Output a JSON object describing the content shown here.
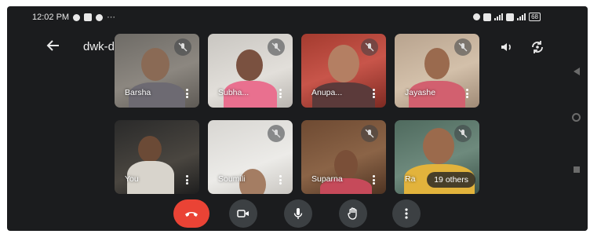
{
  "status_bar": {
    "time": "12:02 PM",
    "left_icons": [
      "whatsapp-icon",
      "video-app-icon",
      "chrome-icon"
    ],
    "overflow": "···",
    "battery": "68"
  },
  "top_bar": {
    "title": "dwk-deyx-yvc",
    "title_chevron": "▸",
    "back_icon": "arrow-left-icon",
    "speaker_icon": "speaker-icon",
    "switch_camera_icon": "switch-camera-icon"
  },
  "participants": [
    {
      "name": "Barsha",
      "muted": true
    },
    {
      "name": "Subha...",
      "muted": true
    },
    {
      "name": "Anupa...",
      "muted": true
    },
    {
      "name": "Jayashe",
      "muted": true
    },
    {
      "name": "You",
      "muted": false
    },
    {
      "name": "Soumili",
      "muted": true
    },
    {
      "name": "Suparna",
      "muted": true
    },
    {
      "name": "Ra",
      "muted": true,
      "others_label": "19 others"
    }
  ],
  "controls": {
    "end_call_icon": "end-call-icon",
    "camera_icon": "camera-icon",
    "mic_icon": "microphone-icon",
    "raise_hand_icon": "raise-hand-icon",
    "more_icon": "more-vertical-icon"
  },
  "colors": {
    "background": "#1b1c1e",
    "end_call": "#ea4335",
    "control": "#3c4043"
  }
}
